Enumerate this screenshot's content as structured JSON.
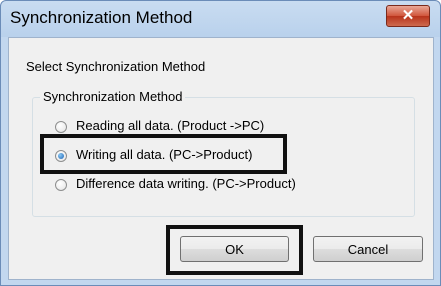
{
  "dialog": {
    "title": "Synchronization Method",
    "close_glyph": "✕",
    "prompt": "Select Synchronization Method",
    "group_label": "Synchronization Method",
    "options": [
      {
        "label": "Reading all data. (Product ->PC)",
        "selected": false
      },
      {
        "label": "Writing all data. (PC->Product)",
        "selected": true
      },
      {
        "label": "Difference data writing. (PC->Product)",
        "selected": false
      }
    ],
    "ok_label": "OK",
    "cancel_label": "Cancel"
  },
  "colors": {
    "highlight": "#111111",
    "close_button": "#c8462c"
  }
}
